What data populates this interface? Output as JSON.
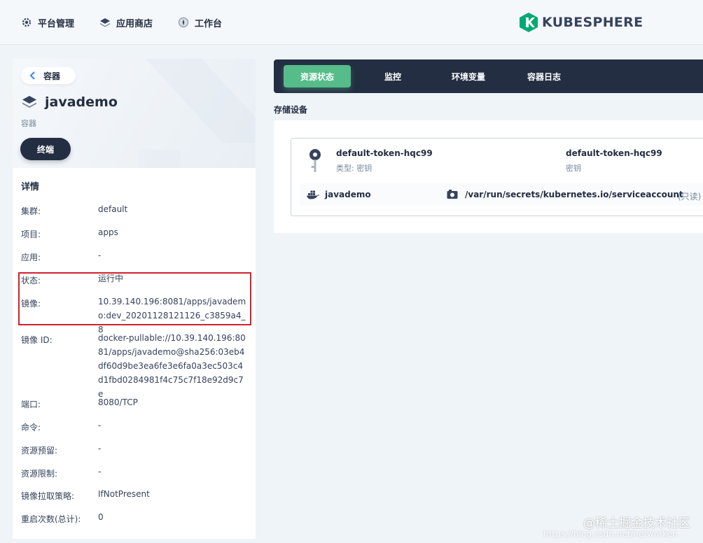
{
  "topnav": {
    "items": [
      {
        "label": "平台管理",
        "icon": "gear-icon"
      },
      {
        "label": "应用商店",
        "icon": "layers-icon"
      },
      {
        "label": "工作台",
        "icon": "compass-icon"
      }
    ],
    "logo_text": "KUBESPHERE",
    "brand_color": "#00a971"
  },
  "header": {
    "back_label": "容器",
    "title": "javademo",
    "subtitle": "容器",
    "terminal_label": "终端"
  },
  "details": {
    "title": "详情",
    "rows": [
      {
        "key": "集群:",
        "value": "default"
      },
      {
        "key": "项目:",
        "value": "apps"
      },
      {
        "key": "应用:",
        "value": "-"
      },
      {
        "key": "状态:",
        "value": "运行中"
      },
      {
        "key": "镜像:",
        "value": "10.39.140.196:8081/apps/javademo:dev_20201128121126_c3859a4_8"
      },
      {
        "key": "镜像 ID:",
        "value": "docker-pullable://10.39.140.196:8081/apps/javademo@sha256:03eb4df60d9be3ea6fe3e6fa0a3ec503c4d1fbd0284981f4c75c7f18e92d9c7e"
      },
      {
        "key": "端口:",
        "value": "8080/TCP"
      },
      {
        "key": "命令:",
        "value": "-"
      },
      {
        "key": "资源预留:",
        "value": "-"
      },
      {
        "key": "资源限制:",
        "value": "-"
      },
      {
        "key": "镜像拉取策略:",
        "value": "IfNotPresent"
      },
      {
        "key": "重启次数(总计):",
        "value": "0"
      }
    ]
  },
  "tabs": [
    {
      "label": "资源状态",
      "active": true
    },
    {
      "label": "监控",
      "active": false
    },
    {
      "label": "环境变量",
      "active": false
    },
    {
      "label": "容器日志",
      "active": false
    }
  ],
  "storage": {
    "section_label": "存储设备",
    "volume": {
      "name": "default-token-hqc99",
      "type_label": "类型: 密钥",
      "secret_name": "default-token-hqc99",
      "secret_label": "密钥"
    },
    "mount": {
      "container": "javademo",
      "path": "/var/run/secrets/kubernetes.io/serviceaccount",
      "mode": "(只读)"
    }
  },
  "watermark": {
    "text": "@稀土掘金技术社区",
    "url_text": "https://blog.csdn.net/networken"
  }
}
